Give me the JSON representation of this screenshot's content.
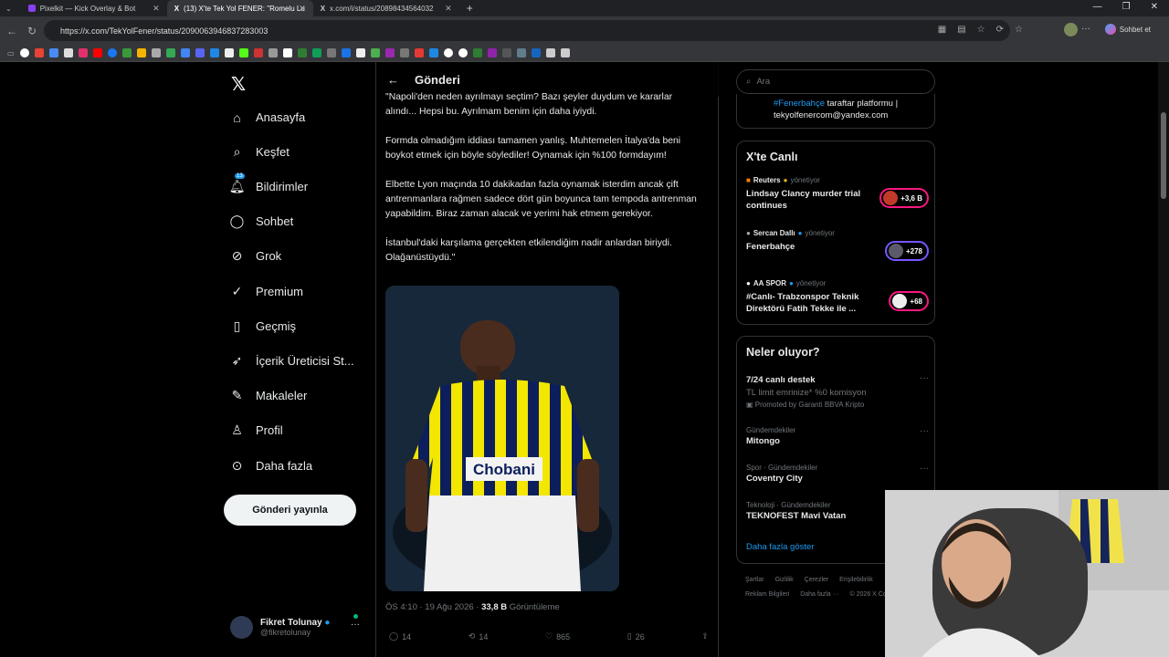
{
  "browser": {
    "tabs": [
      {
        "label": "Pixelkit — Kick Overlay & Bot"
      },
      {
        "label": "(13) X'te Tek Yol FENER: \"Romelu Lu"
      },
      {
        "label": "x.com/i/status/20898434564032"
      }
    ],
    "url": "https://x.com/TekYolFener/status/2090063946837283003",
    "chat_label": "Sohbet et"
  },
  "nav": {
    "items": [
      {
        "label": "Anasayfa",
        "icon": "home-icon"
      },
      {
        "label": "Keşfet",
        "icon": "search-icon"
      },
      {
        "label": "Bildirimler",
        "icon": "bell-icon",
        "badge": "13"
      },
      {
        "label": "Sohbet",
        "icon": "chat-icon"
      },
      {
        "label": "Grok",
        "icon": "grok-icon"
      },
      {
        "label": "Premium",
        "icon": "premium-icon"
      },
      {
        "label": "Geçmiş",
        "icon": "bookmark-icon"
      },
      {
        "label": "İçerik Üreticisi St...",
        "icon": "rocket-icon"
      },
      {
        "label": "Makaleler",
        "icon": "articles-icon"
      },
      {
        "label": "Profil",
        "icon": "profile-icon"
      },
      {
        "label": "Daha fazla",
        "icon": "more-circle-icon"
      }
    ],
    "post_button": "Gönderi yayınla",
    "account": {
      "name": "Fikret Tolunay",
      "handle": "@fikretolunay"
    }
  },
  "post": {
    "header": "Gönderi",
    "paragraphs": [
      "\"Napoli'den neden ayrılmayı seçtim? Bazı şeyler duydum ve kararlar alındı... Hepsi bu. Ayrılmam benim için daha iyiydi.",
      "Formda olmadığım iddiası tamamen yanlış. Muhtemelen İtalya'da beni boykot etmek için böyle söylediler! Oynamak için %100 formdayım!",
      "Elbette Lyon maçında 10 dakikadan fazla oynamak isterdim ancak çift antrenmanlara rağmen sadece dört gün boyunca tam tempoda antrenman yapabildim. Biraz zaman alacak ve yerimi hak etmem gerekiyor.",
      "İstanbul'daki karşılama gerçekten etkilendiğim nadir anlardan biriydi. Olağanüstüydü.\""
    ],
    "image_text": "Chobani",
    "time": "ÖS 4:10 · 19 Ağu 2026 · ",
    "views": "33,8 B",
    "views_label": " Görüntüleme",
    "replies": "14",
    "reposts": "14",
    "likes": "865",
    "bookmarks": "26"
  },
  "right": {
    "search_placeholder": "Ara",
    "promo_hashtag": "#Fenerbahçe",
    "promo_line1": " taraftar platformu |",
    "promo_line2": "tekyolfenercom@yandex.com",
    "live_title": "X'te Canlı",
    "live": [
      {
        "source": "Reuters",
        "sub": "yönetiyor",
        "title": "Lindsay Clancy murder trial continues",
        "count": "+3,6 B"
      },
      {
        "source": "Sercan Dallı",
        "sub": "yönetiyor",
        "title": "Fenerbahçe",
        "count": "+278"
      },
      {
        "source": "AA SPOR",
        "sub": "yönetiyor",
        "title": "#Canlı- Trabzonspor Teknik Direktörü Fatih Tekke ile ...",
        "count": "+68"
      }
    ],
    "trends_title": "Neler oluyor?",
    "trends": [
      {
        "category": "",
        "name": "7/24 canlı destek",
        "sub": "TL limit emrinize* %0 komisyon",
        "promo": "Promoted by Garanti BBVA Kripto"
      },
      {
        "category": "Gündemdekiler",
        "name": "Mitongo"
      },
      {
        "category": "Spor · Gündemdekiler",
        "name": "Coventry City"
      },
      {
        "category": "Teknoloji · Gündemdekiler",
        "name": "TEKNOFEST Mavi Vatan"
      }
    ],
    "show_more": "Daha fazla göster",
    "footer": [
      "Şartlar",
      "Gizlilik",
      "Çerezler",
      "Erişilebilirlik",
      "Reklam Bilgileri",
      "Daha fazla ···",
      "© 2026 X Co"
    ]
  }
}
